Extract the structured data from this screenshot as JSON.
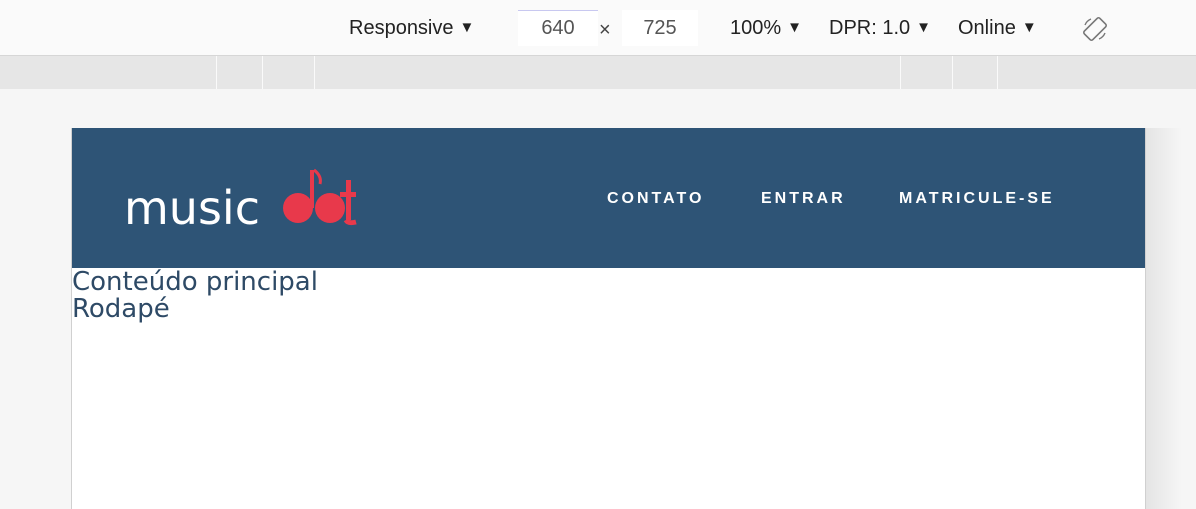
{
  "toolbar": {
    "device_label": "Responsive",
    "width_value": "640",
    "height_value": "725",
    "dimension_separator": "×",
    "zoom_label": "100%",
    "dpr_label": "DPR: 1.0",
    "network_label": "Online",
    "caret": "▼",
    "rotate_icon": "rotate-icon"
  },
  "site": {
    "logo_text": "musicdot",
    "logo_colors": {
      "music": "#ffffff",
      "dot": "#e8394b"
    },
    "header_color": "#2e5476",
    "nav": [
      {
        "label": "CONTATO"
      },
      {
        "label": "ENTRAR"
      },
      {
        "label": "MATRICULE-SE"
      }
    ],
    "main_text": "Conteúdo principal",
    "footer_text": "Rodapé"
  }
}
